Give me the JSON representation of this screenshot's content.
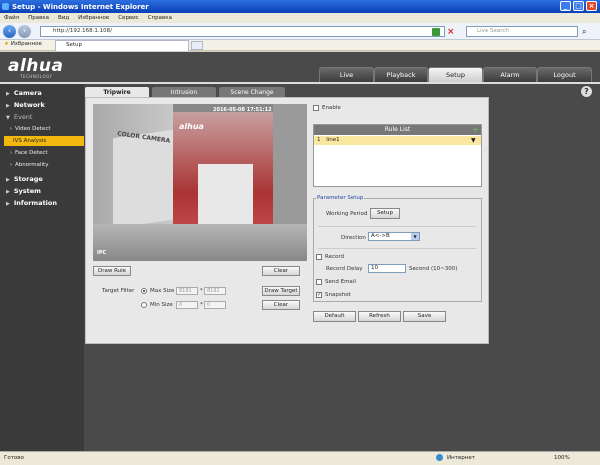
{
  "window": {
    "title": "Setup - Windows Internet Explorer"
  },
  "menu": [
    "Файл",
    "Правка",
    "Вид",
    "Избранное",
    "Сервис",
    "Справка"
  ],
  "browser": {
    "address": "http://192.168.1.108/",
    "search_placeholder": "Live Search",
    "favorites": "Избранное",
    "tab_title": "Setup"
  },
  "app": {
    "logo": "alhua",
    "logo_sub": "TECHNOLOGY"
  },
  "topnav": [
    "Live",
    "Playback",
    "Setup",
    "Alarm",
    "Logout"
  ],
  "topnav_active": "Setup",
  "sidebar": {
    "camera": "Camera",
    "network": "Network",
    "event": "Event",
    "video_detect": "Video Detect",
    "ivs_analysis": "IVS Analysis",
    "face_detect": "Face Detect",
    "abnormality": "Abnormality",
    "storage": "Storage",
    "system": "System",
    "information": "Information"
  },
  "tabs": [
    "Tripwire",
    "Intrusion",
    "Scene Change"
  ],
  "video": {
    "timestamp": "2016-05-08 17:51:12",
    "brand_text": "COLOR CAMERA",
    "logo_text": "alhua",
    "cam_label": "IPC"
  },
  "buttons": {
    "draw_rule": "Draw Rule",
    "clear_video": "Clear",
    "draw_target": "Draw Target",
    "clear_target": "Clear",
    "default": "Default",
    "refresh": "Refresh",
    "save": "Save",
    "setup": "Setup"
  },
  "target_filter": {
    "label": "Target Filter",
    "max_size": "Max Size",
    "min_size": "Min Size",
    "max_w": "8191",
    "max_h": "8191",
    "min_w": "0",
    "min_h": "0",
    "x": "*"
  },
  "enable": "Enable",
  "rule_list": {
    "title": "Rule List",
    "rows": [
      {
        "num": "1",
        "name": "line1"
      }
    ]
  },
  "param": {
    "title": "Parameter Setup",
    "working_period": "Working Period",
    "direction": "Direction",
    "direction_value": "A<->B",
    "record": "Record",
    "record_delay": "Record Delay",
    "record_delay_value": "10",
    "record_delay_unit": "Second (10~300)",
    "send_email": "Send Email",
    "snapshot": "Snapshot"
  },
  "status": {
    "left": "Готово",
    "zone": "Интернет",
    "zoom": "100%"
  }
}
